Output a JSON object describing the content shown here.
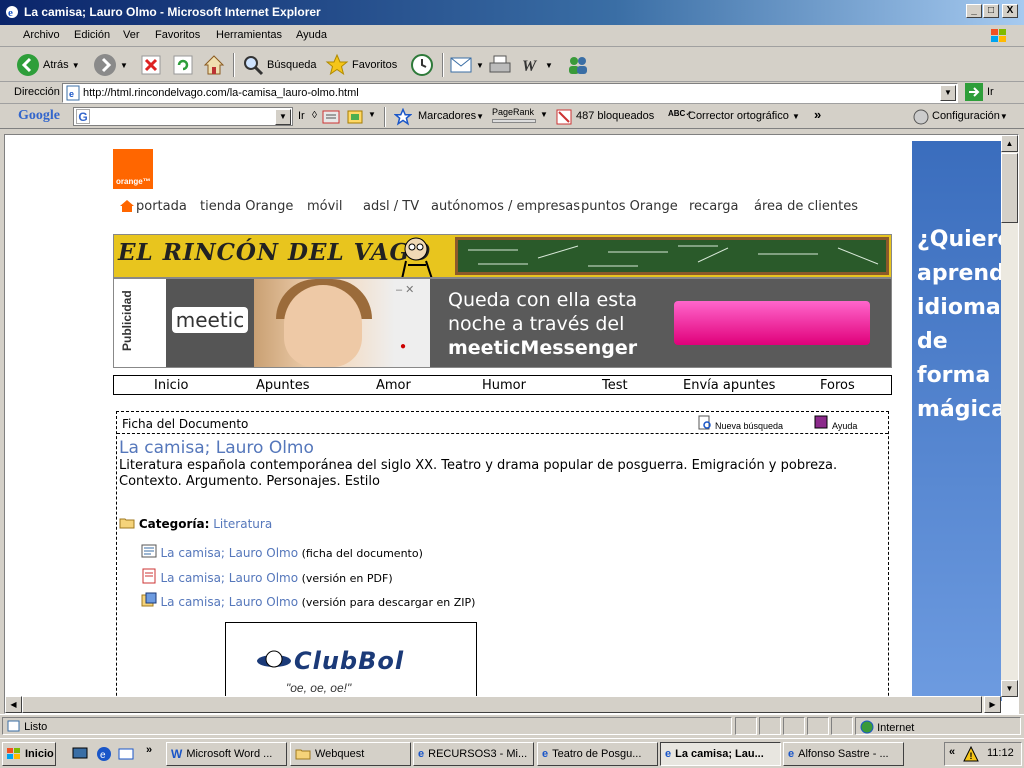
{
  "window": {
    "title": "La camisa; Lauro Olmo - Microsoft Internet Explorer",
    "controls": [
      "_",
      "□",
      "X"
    ]
  },
  "menu": [
    "Archivo",
    "Edición",
    "Ver",
    "Favoritos",
    "Herramientas",
    "Ayuda"
  ],
  "toolbar": {
    "back": "Atrás",
    "search": "Búsqueda",
    "favorites": "Favoritos"
  },
  "address": {
    "label": "Dirección",
    "url": "http://html.rincondelvago.com/la-camisa_lauro-olmo.html",
    "go": "Ir"
  },
  "googlebar": {
    "logo": "Google",
    "go": "Ir",
    "bookmarks": "Marcadores",
    "pagerank": "PageRank",
    "blocked": "487 bloqueados",
    "spell": "Corrector ortográfico",
    "config": "Configuración"
  },
  "page": {
    "orange_logo": "orange™",
    "topnav": [
      "portada",
      "tienda Orange",
      "móvil",
      "adsl / TV",
      "autónomos / empresas",
      "puntos Orange",
      "recarga",
      "área de clientes"
    ],
    "vago_title": "EL RINCÓN DEL VAGO",
    "ad": {
      "label": "Publicidad",
      "brand": "meetic",
      "line1": "Queda con ella esta",
      "line2": "noche a través del",
      "line3": "meeticMessenger"
    },
    "mainmenu": [
      "Inicio",
      "Apuntes",
      "Amor",
      "Humor",
      "Test",
      "Envía apuntes",
      "Foros"
    ],
    "ficha": {
      "heading": "Ficha del Documento",
      "new_search": "Nueva búsqueda",
      "help": "Ayuda",
      "title": "La camisa; Lauro Olmo",
      "description": "Literatura española contemporánea del siglo XX. Teatro y drama popular de posguerra. Emigración y pobreza. Contexto. Argumento. Personajes. Estilo",
      "category_label": "Categoría:",
      "category": "Literatura",
      "downloads": [
        {
          "link": "La camisa; Lauro Olmo",
          "note": "(ficha del documento)"
        },
        {
          "link": "La camisa; Lauro Olmo",
          "note": "(versión en PDF)"
        },
        {
          "link": "La camisa; Lauro Olmo",
          "note": "(versión para descargar en ZIP)"
        }
      ]
    },
    "clubbol": {
      "logo": "ClubBol",
      "slogan": "\"oe, oe, oe!\""
    },
    "side_ad": [
      "¿Quiere",
      "aprend",
      "idiomas",
      "de",
      "forma",
      "mágica"
    ]
  },
  "status": {
    "text": "Listo",
    "zone": "Internet"
  },
  "taskbar": {
    "start": "Inicio",
    "tasks": [
      {
        "label": "Microsoft Word ...",
        "active": false
      },
      {
        "label": "Webquest",
        "active": false
      },
      {
        "label": "RECURSOS3 - Mi...",
        "active": false
      },
      {
        "label": "Teatro de Posgu...",
        "active": false
      },
      {
        "label": "La camisa; Lau...",
        "active": true
      },
      {
        "label": "Alfonso Sastre - ...",
        "active": false
      }
    ],
    "clock": "11:12"
  },
  "colors": {
    "titlebar": "#0a246a",
    "link": "#5577bb",
    "orange": "#ff6600"
  }
}
